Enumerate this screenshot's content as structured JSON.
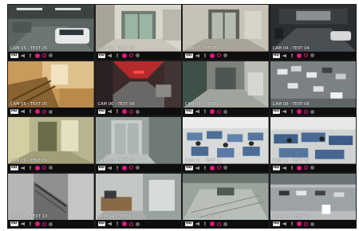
{
  "colors": {
    "frame": "#1c1c1c",
    "statusbar": "#0e0e0e",
    "rec": "#e2177e",
    "label_text": "#ffffff"
  },
  "cameras": [
    {
      "label": "CAM 05 - TEXT 05",
      "hd": "HD",
      "scene": "parking-garage-car"
    },
    {
      "label": "CAM 02 - TEXT 02",
      "hd": "HD",
      "scene": "lobby-glass-door"
    },
    {
      "label": "CAM 03 - TEXT 03",
      "hd": "HD",
      "scene": "elevator-lobby-door"
    },
    {
      "label": "CAM 04 - TEXT 04",
      "hd": "HD",
      "scene": "parking-entrance-night"
    },
    {
      "label": "CAM 05 - TEXT 05",
      "hd": "HD",
      "scene": "stairwell-wood"
    },
    {
      "label": "CAM 06 - TEXT 06",
      "hd": "HD",
      "scene": "corridor-red-light"
    },
    {
      "label": "CAM 07 - TEXT 07",
      "hd": "HD",
      "scene": "hallway-tiles"
    },
    {
      "label": "CAM 08 - TEXT 08",
      "hd": "HD",
      "scene": "parking-lot-aerial"
    },
    {
      "label": "CAM 09 - TEXT 09",
      "hd": "HD",
      "scene": "hallway-green-door"
    },
    {
      "label": "CAM 10 - TEXT 10",
      "hd": "HD",
      "scene": "elevator-steel"
    },
    {
      "label": "CAM 11 - TEXT 11",
      "hd": "HD",
      "scene": "office-open-plan"
    },
    {
      "label": "CAM 12 - TEXT 12",
      "hd": "HD",
      "scene": "office-cubicles"
    },
    {
      "label": "CAM 13 - TEXT 13",
      "hd": "HD",
      "scene": "stairwell-grey"
    },
    {
      "label": "CAM 14 - TEXT 14",
      "hd": "HD",
      "scene": "room-desk"
    },
    {
      "label": "CAM 15 - TEXT 15",
      "hd": "HD",
      "scene": "plaza-fountain"
    },
    {
      "label": "CAM 16 - TEXT 16",
      "hd": "HD",
      "scene": "road-cars"
    }
  ]
}
